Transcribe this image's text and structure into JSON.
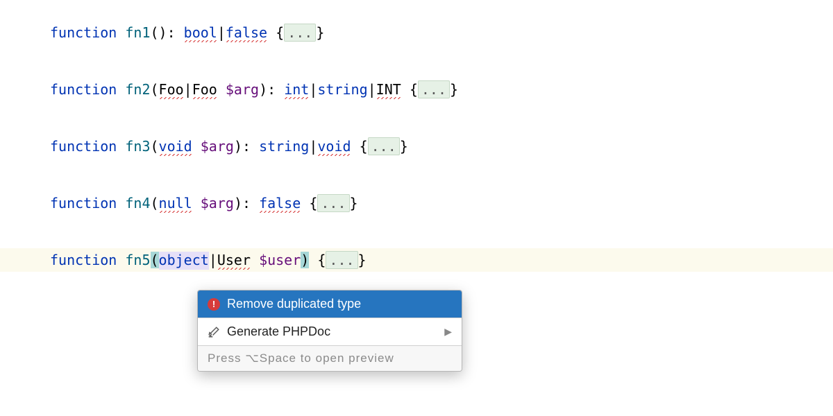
{
  "keyword_function": "function",
  "fold_marker": "...",
  "lines": {
    "l1": {
      "name": "fn1",
      "ret1": "bool",
      "ret2": "false"
    },
    "l2": {
      "name": "fn2",
      "p_t1": "Foo",
      "p_t2": "Foo",
      "p_var": "$arg",
      "r1": "int",
      "r2": "string",
      "r3": "INT"
    },
    "l3": {
      "name": "fn3",
      "p_t": "void",
      "p_var": "$arg",
      "r1": "string",
      "r2": "void"
    },
    "l4": {
      "name": "fn4",
      "p_t": "null",
      "p_var": "$arg",
      "r1": "false"
    },
    "l5": {
      "name": "fn5",
      "p_t1": "object",
      "p_t2": "User",
      "p_var": "$user"
    }
  },
  "popup": {
    "item1": "Remove duplicated type",
    "item2": "Generate PHPDoc",
    "hint_prefix": "Press ",
    "hint_key": "⌥",
    "hint_key2": "Space",
    "hint_suffix": " to open preview"
  }
}
